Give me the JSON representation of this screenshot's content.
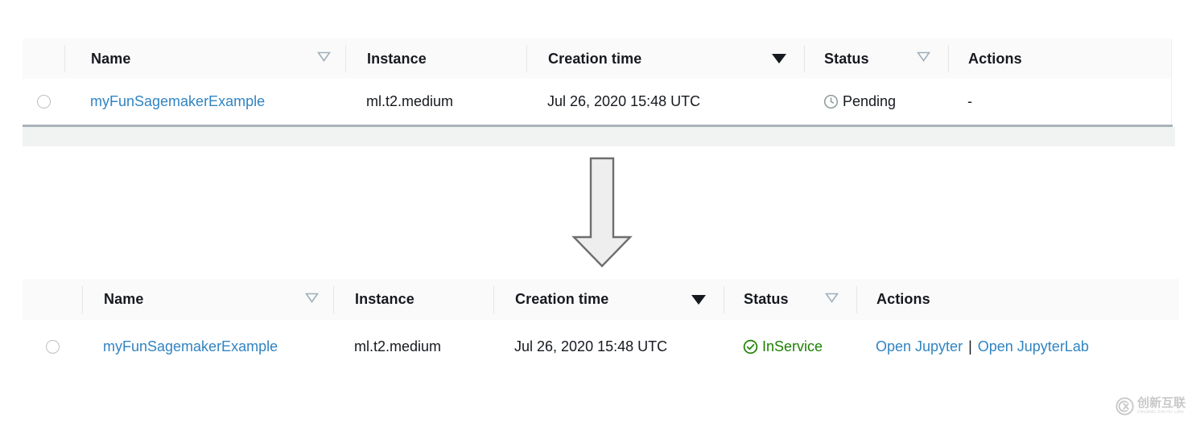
{
  "tables": [
    {
      "id": "pending-table",
      "columns": [
        {
          "label": "Name",
          "sort": "unsorted"
        },
        {
          "label": "Instance",
          "sort": "none"
        },
        {
          "label": "Creation time",
          "sort": "descending"
        },
        {
          "label": "Status",
          "sort": "unsorted"
        },
        {
          "label": "Actions",
          "sort": "none"
        }
      ],
      "rows": [
        {
          "selected": false,
          "name": "myFunSagemakerExample",
          "instance": "ml.t2.medium",
          "creation_time": "Jul 26, 2020 15:48 UTC",
          "status": {
            "label": "Pending",
            "icon": "clock-icon",
            "color": "#16191f"
          },
          "actions": {
            "placeholder": "-",
            "links": []
          }
        }
      ]
    },
    {
      "id": "inservice-table",
      "columns": [
        {
          "label": "Name",
          "sort": "unsorted"
        },
        {
          "label": "Instance",
          "sort": "none"
        },
        {
          "label": "Creation time",
          "sort": "descending"
        },
        {
          "label": "Status",
          "sort": "unsorted"
        },
        {
          "label": "Actions",
          "sort": "none"
        }
      ],
      "rows": [
        {
          "selected": false,
          "name": "myFunSagemakerExample",
          "instance": "ml.t2.medium",
          "creation_time": "Jul 26, 2020 15:48 UTC",
          "status": {
            "label": "InService",
            "icon": "check-circle-icon",
            "color": "#1d8102"
          },
          "actions": {
            "placeholder": "",
            "links": [
              "Open Jupyter",
              "Open JupyterLab"
            ],
            "separator": "|"
          }
        }
      ]
    }
  ],
  "arrow": {
    "icon": "down-arrow-icon",
    "direction": "down",
    "fill": "#eeeeee",
    "stroke": "#6e6e6e"
  },
  "watermark": {
    "icon": "cx-logo-icon",
    "name_cn": "创新互联",
    "name_pinyin": "CHUANG XIN HU LIAN"
  },
  "colors": {
    "link": "#3184c2",
    "text": "#16191f",
    "success": "#1d8102",
    "header_bg": "#fafafa",
    "border": "#eaedf0"
  }
}
